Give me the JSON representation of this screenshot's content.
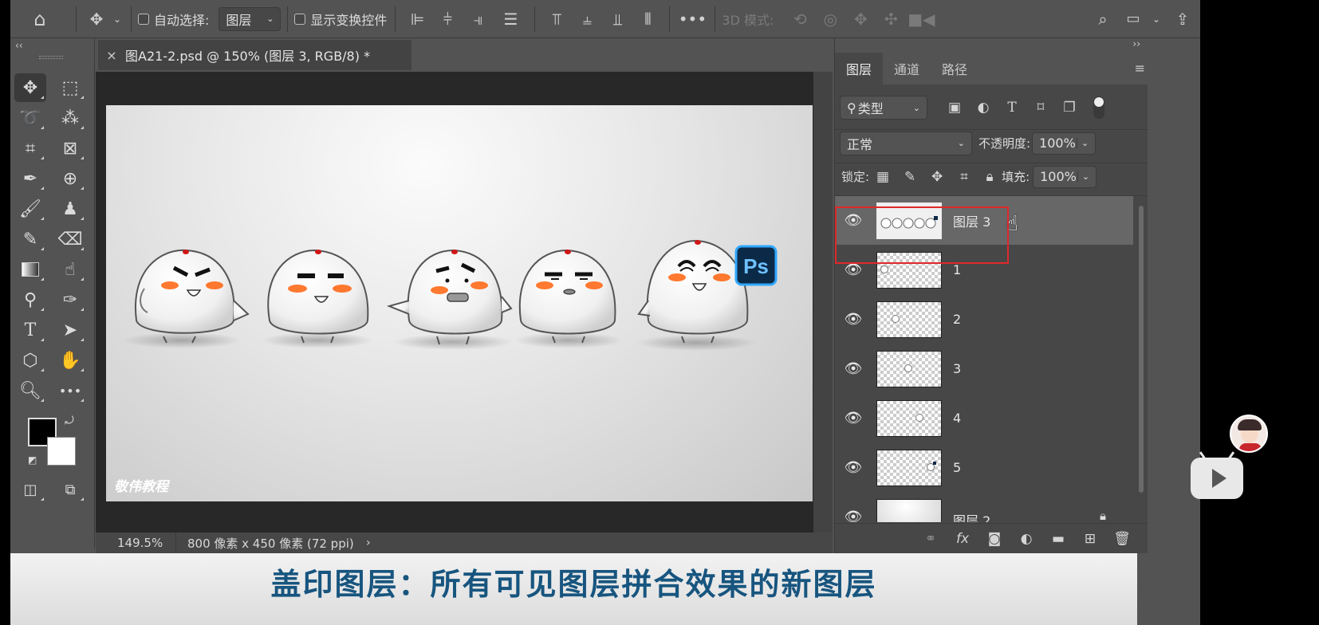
{
  "options_bar": {
    "home_icon": "home-icon",
    "auto_select_label": "自动选择:",
    "auto_select_target": "图层",
    "show_transform_label": "显示变换控件",
    "mode_3d_label": "3D 模式:"
  },
  "document": {
    "tab_title": "图A21-2.psd @ 150% (图层 3, RGB/8) *",
    "zoom": "149.5%",
    "size_info": "800 像素 x 450 像素 (72 ppi)",
    "watermark": "敬伟教程",
    "badge_text": "Ps"
  },
  "layers_panel": {
    "tabs": [
      "图层",
      "通道",
      "路径"
    ],
    "filter_label": "类型",
    "blend_mode": "正常",
    "opacity_label": "不透明度:",
    "opacity_value": "100%",
    "lock_label": "锁定:",
    "fill_label": "填充:",
    "fill_value": "100%",
    "layers": [
      {
        "name": "图层 3",
        "selected": true
      },
      {
        "name": "1",
        "selected": false
      },
      {
        "name": "2",
        "selected": false
      },
      {
        "name": "3",
        "selected": false
      },
      {
        "name": "4",
        "selected": false
      },
      {
        "name": "5",
        "selected": false
      },
      {
        "name": "图层 2",
        "selected": false,
        "locked": true
      }
    ],
    "highlight_color": "#e0282a"
  },
  "subtitle": "盖印图层：所有可见图层拼合效果的新图层",
  "colors": {
    "ui_bg": "#535353",
    "ps_badge": "#0b2a48",
    "ps_badge_border": "#31a8ff",
    "subtitle_text": "#17557f"
  }
}
